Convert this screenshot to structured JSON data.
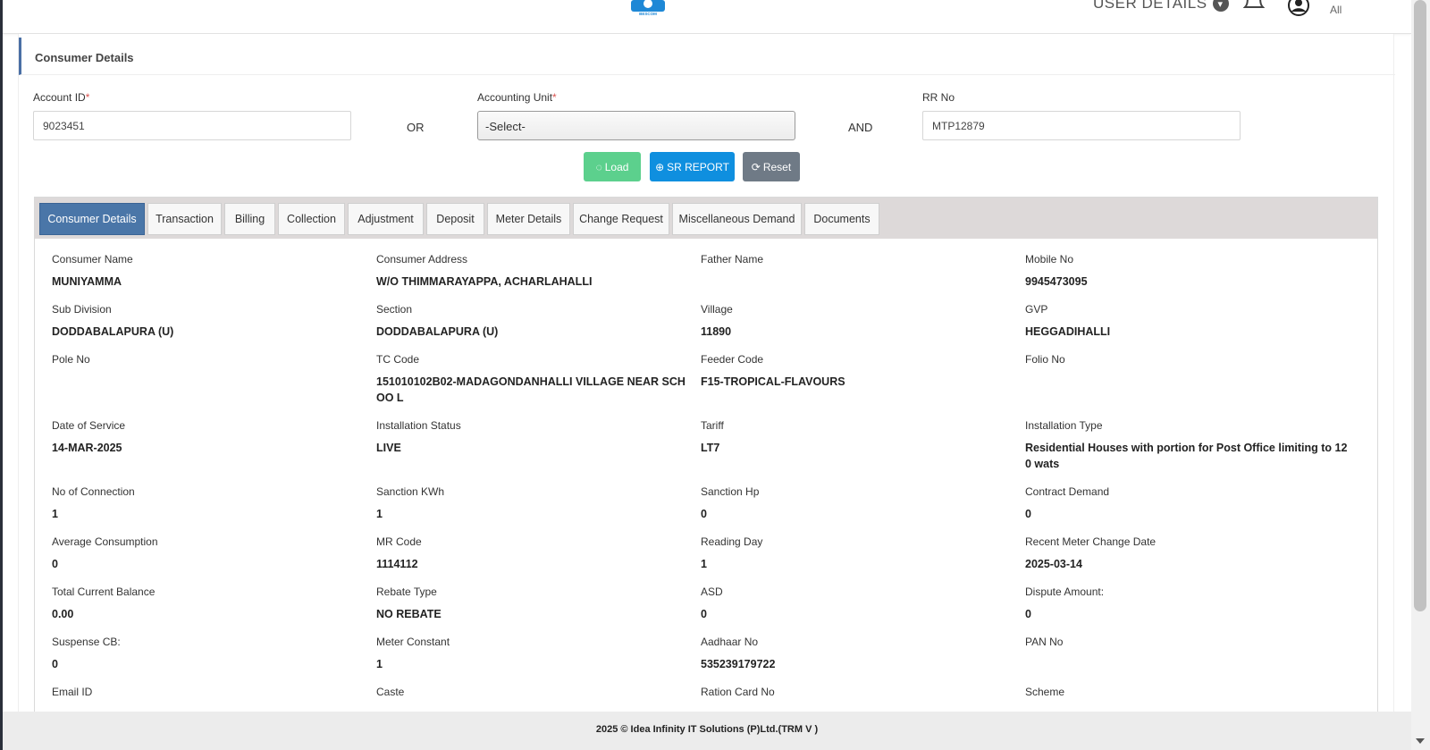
{
  "header": {
    "logo_text": "BESCOM",
    "user_details_label": "USER DETAILS",
    "user_role": "All"
  },
  "section": {
    "title": "Consumer Details"
  },
  "form": {
    "account_id_label": "Account ID",
    "account_id_value": "9023451",
    "or_label": "OR",
    "accounting_unit_label": "Accounting Unit",
    "accounting_unit_value": "-Select-",
    "and_label": "AND",
    "rr_no_label": "RR No",
    "rr_no_value": "MTP12879",
    "required_mark": "*"
  },
  "buttons": {
    "load": "Load",
    "sr_report": "SR REPORT",
    "reset": "Reset"
  },
  "tabs": [
    "Consumer Details",
    "Transaction",
    "Billing",
    "Collection",
    "Adjustment",
    "Deposit",
    "Meter Details",
    "Change Request",
    "Miscellaneous Demand",
    "Documents"
  ],
  "details": {
    "consumer_name": {
      "label": "Consumer Name",
      "value": "MUNIYAMMA"
    },
    "consumer_address": {
      "label": "Consumer Address",
      "value": "W/O THIMMARAYAPPA, ACHARLAHALLI"
    },
    "father_name": {
      "label": "Father Name",
      "value": ""
    },
    "mobile_no": {
      "label": "Mobile No",
      "value": "9945473095"
    },
    "sub_division": {
      "label": "Sub Division",
      "value": "DODDABALAPURA (U)"
    },
    "section": {
      "label": "Section",
      "value": "DODDABALAPURA (U)"
    },
    "village": {
      "label": "Village",
      "value": "11890"
    },
    "gvp": {
      "label": "GVP",
      "value": "HEGGADIHALLI"
    },
    "pole_no": {
      "label": "Pole No",
      "value": ""
    },
    "tc_code": {
      "label": "TC Code",
      "value": "151010102B02-MADAGONDANHALLI VILLAGE NEAR SCHOO L"
    },
    "feeder_code": {
      "label": "Feeder Code",
      "value": "F15-TROPICAL-FLAVOURS"
    },
    "folio_no": {
      "label": "Folio No",
      "value": ""
    },
    "date_of_service": {
      "label": "Date of Service",
      "value": "14-MAR-2025"
    },
    "installation_status": {
      "label": "Installation Status",
      "value": "LIVE"
    },
    "tariff": {
      "label": "Tariff",
      "value": "LT7"
    },
    "installation_type": {
      "label": "Installation Type",
      "value": "Residential Houses with portion for Post Office limiting to 12 0 wats"
    },
    "no_of_connection": {
      "label": "No of Connection",
      "value": "1"
    },
    "sanction_kwh": {
      "label": "Sanction KWh",
      "value": "1"
    },
    "sanction_hp": {
      "label": "Sanction Hp",
      "value": "0"
    },
    "contract_demand": {
      "label": "Contract Demand",
      "value": "0"
    },
    "average_consumption": {
      "label": "Average Consumption",
      "value": "0"
    },
    "mr_code": {
      "label": "MR Code",
      "value": "1114112"
    },
    "reading_day": {
      "label": "Reading Day",
      "value": "1"
    },
    "recent_meter_change_date": {
      "label": "Recent Meter Change Date",
      "value": "2025-03-14"
    },
    "total_current_balance": {
      "label": "Total Current Balance",
      "value": "0.00"
    },
    "rebate_type": {
      "label": "Rebate Type",
      "value": "NO REBATE"
    },
    "asd": {
      "label": "ASD",
      "value": "0"
    },
    "dispute_amount": {
      "label": "Dispute Amount:",
      "value": "0"
    },
    "suspense_cb": {
      "label": "Suspense CB:",
      "value": "0"
    },
    "meter_constant": {
      "label": "Meter Constant",
      "value": "1"
    },
    "aadhaar_no": {
      "label": "Aadhaar No",
      "value": "535239179722"
    },
    "pan_no": {
      "label": "PAN No",
      "value": ""
    },
    "email_id": {
      "label": "Email ID",
      "value": ""
    },
    "caste": {
      "label": "Caste",
      "value": ""
    },
    "ration_card_no": {
      "label": "Ration Card No",
      "value": ""
    },
    "scheme": {
      "label": "Scheme",
      "value": ""
    }
  },
  "footer": {
    "text": "2025 © Idea Infinity IT Solutions (P)Ltd.(TRM V )"
  },
  "colors": {
    "accent": "#4a76a8",
    "load": "#5cd08d",
    "sr_report": "#0f8fdf",
    "reset": "#6f7a86"
  }
}
